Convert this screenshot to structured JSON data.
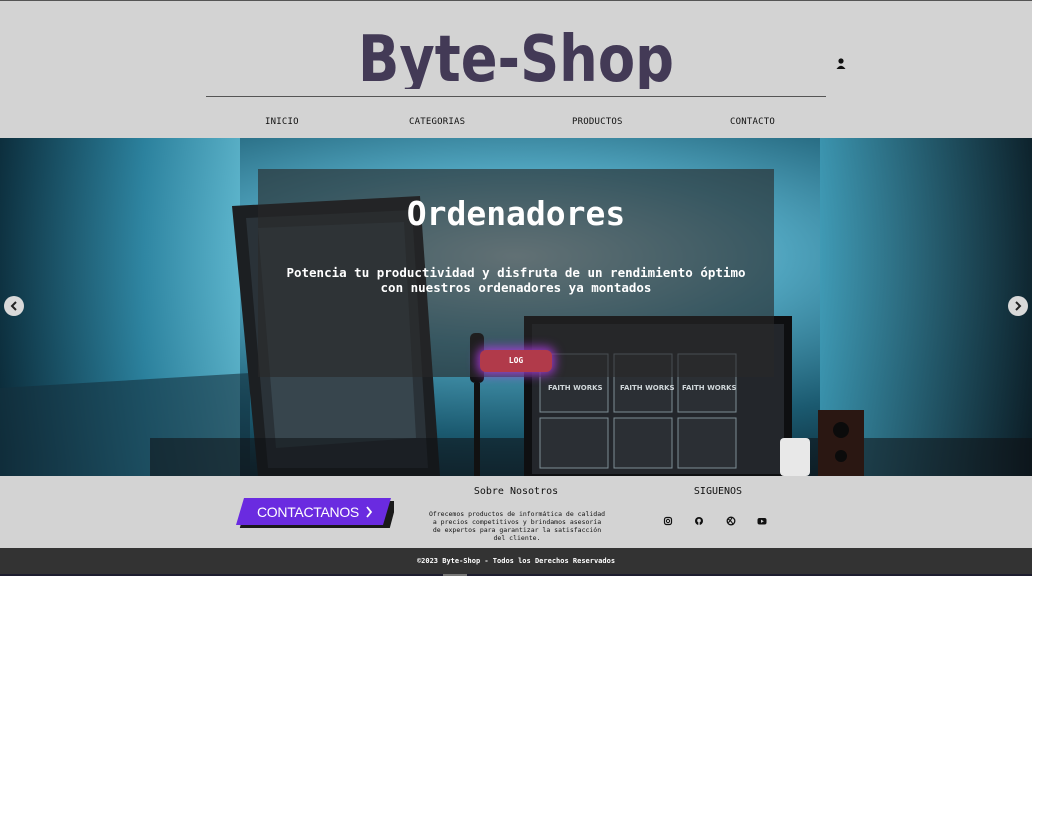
{
  "header": {
    "logo_text": "Byte-Shop",
    "nav": [
      "INICIO",
      "CATEGORIAS",
      "PRODUCTOS",
      "CONTACTO"
    ]
  },
  "hero": {
    "title": "Ordenadores",
    "subtitle": "Potencia tu productividad y disfruta de un rendimiento óptimo con nuestros ordenadores ya montados",
    "button_label": "LOG",
    "screen_text": "FAITH WORKS"
  },
  "footer": {
    "contact_label": "CONTACTANOS",
    "about_title": "Sobre Nosotros",
    "about_text": "Ofrecemos productos de informática de calidad a precios competitivos y brindamos asesoría de expertos para garantizar la satisfacción del cliente.",
    "follow_title": "SIGUENOS",
    "social_icons": [
      "instagram-icon",
      "github-icon",
      "dribbble-icon",
      "youtube-icon"
    ],
    "copyright": "©2023 Byte-Shop - Todos los Derechos Reservados"
  },
  "colors": {
    "logo": "#433a56",
    "contact_button": "#6a2be0",
    "hero_button": "#b13a4a",
    "header_bg": "#d3d3d3",
    "bottom_bar": "#333333"
  }
}
